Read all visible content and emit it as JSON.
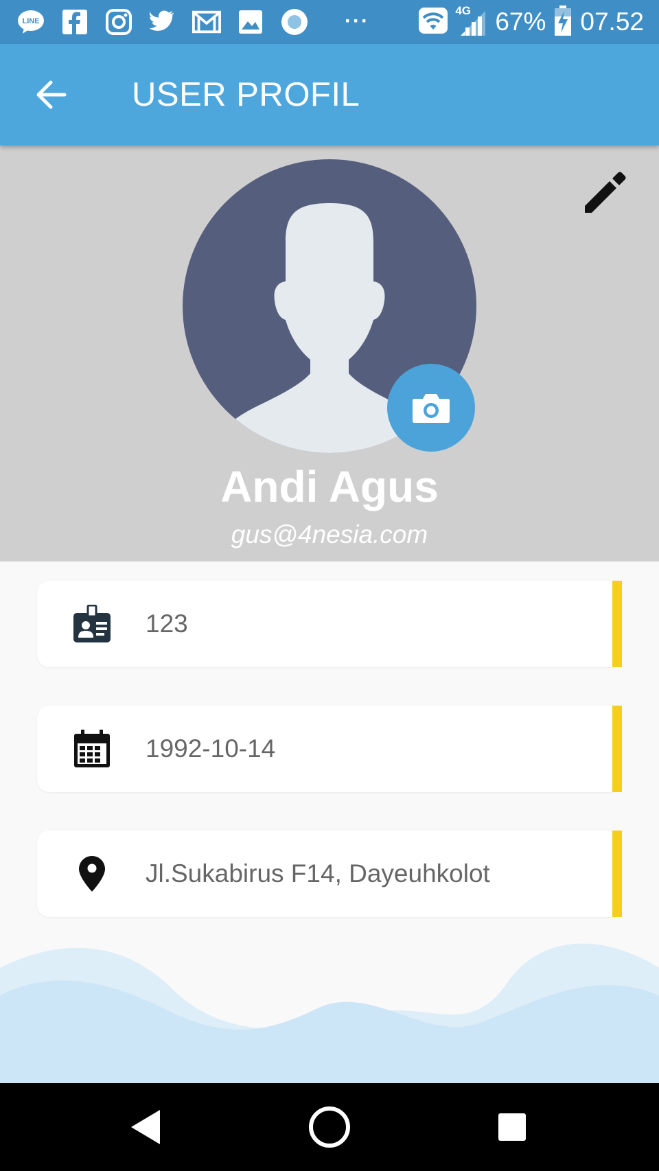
{
  "status_bar": {
    "icons_left": [
      "line-icon",
      "facebook-icon",
      "instagram-icon",
      "twitter-bird-icon",
      "gmail-icon",
      "gallery-icon",
      "record-icon"
    ],
    "more": "···",
    "network": "4G",
    "battery": "67%",
    "time": "07.52"
  },
  "app_bar": {
    "title": "USER PROFIL"
  },
  "profile": {
    "name": "Andi Agus",
    "email": "gus@4nesia.com"
  },
  "fields": [
    {
      "icon": "id-card-icon",
      "value": "123"
    },
    {
      "icon": "calendar-icon",
      "value": "1992-10-14"
    },
    {
      "icon": "location-pin-icon",
      "value": "Jl.Sukabirus F14, Dayeuhkolot"
    }
  ],
  "colors": {
    "status_bar": "#3f8fc6",
    "app_bar": "#4da6dc",
    "header_bg": "#cfcfcf",
    "avatar_bg": "#555f7d",
    "camera_button": "#4ba3d9",
    "card_accent": "#f5cf1d",
    "wave": "#cde6f7"
  }
}
